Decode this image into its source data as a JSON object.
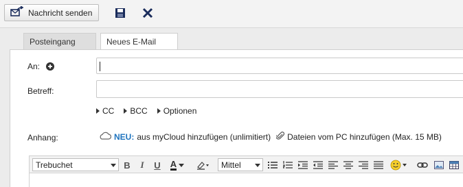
{
  "toolbar": {
    "send_label": "Nachricht senden",
    "icons": [
      "send-icon",
      "save-icon",
      "close-icon"
    ]
  },
  "tabs": [
    {
      "label": "Posteingang",
      "active": false
    },
    {
      "label": "Neues E-Mail",
      "active": true
    }
  ],
  "form": {
    "to_label": "An:",
    "to_value": "",
    "subject_label": "Betreff:",
    "subject_value": "",
    "options": [
      "CC",
      "BCC",
      "Optionen"
    ],
    "attachment_label": "Anhang:",
    "mycloud_new": "NEU:",
    "mycloud_text": "aus myCloud hinzufügen (unlimitiert)",
    "pc_text": "Dateien vom PC hinzufügen (Max. 15 MB)"
  },
  "editor": {
    "font": "Trebuchet",
    "size": "Mittel",
    "bold": "B",
    "italic": "I",
    "underline": "U",
    "font_color": "A"
  },
  "colors": {
    "accent": "#1e73be",
    "navy_icon": "#1a2c5b"
  }
}
